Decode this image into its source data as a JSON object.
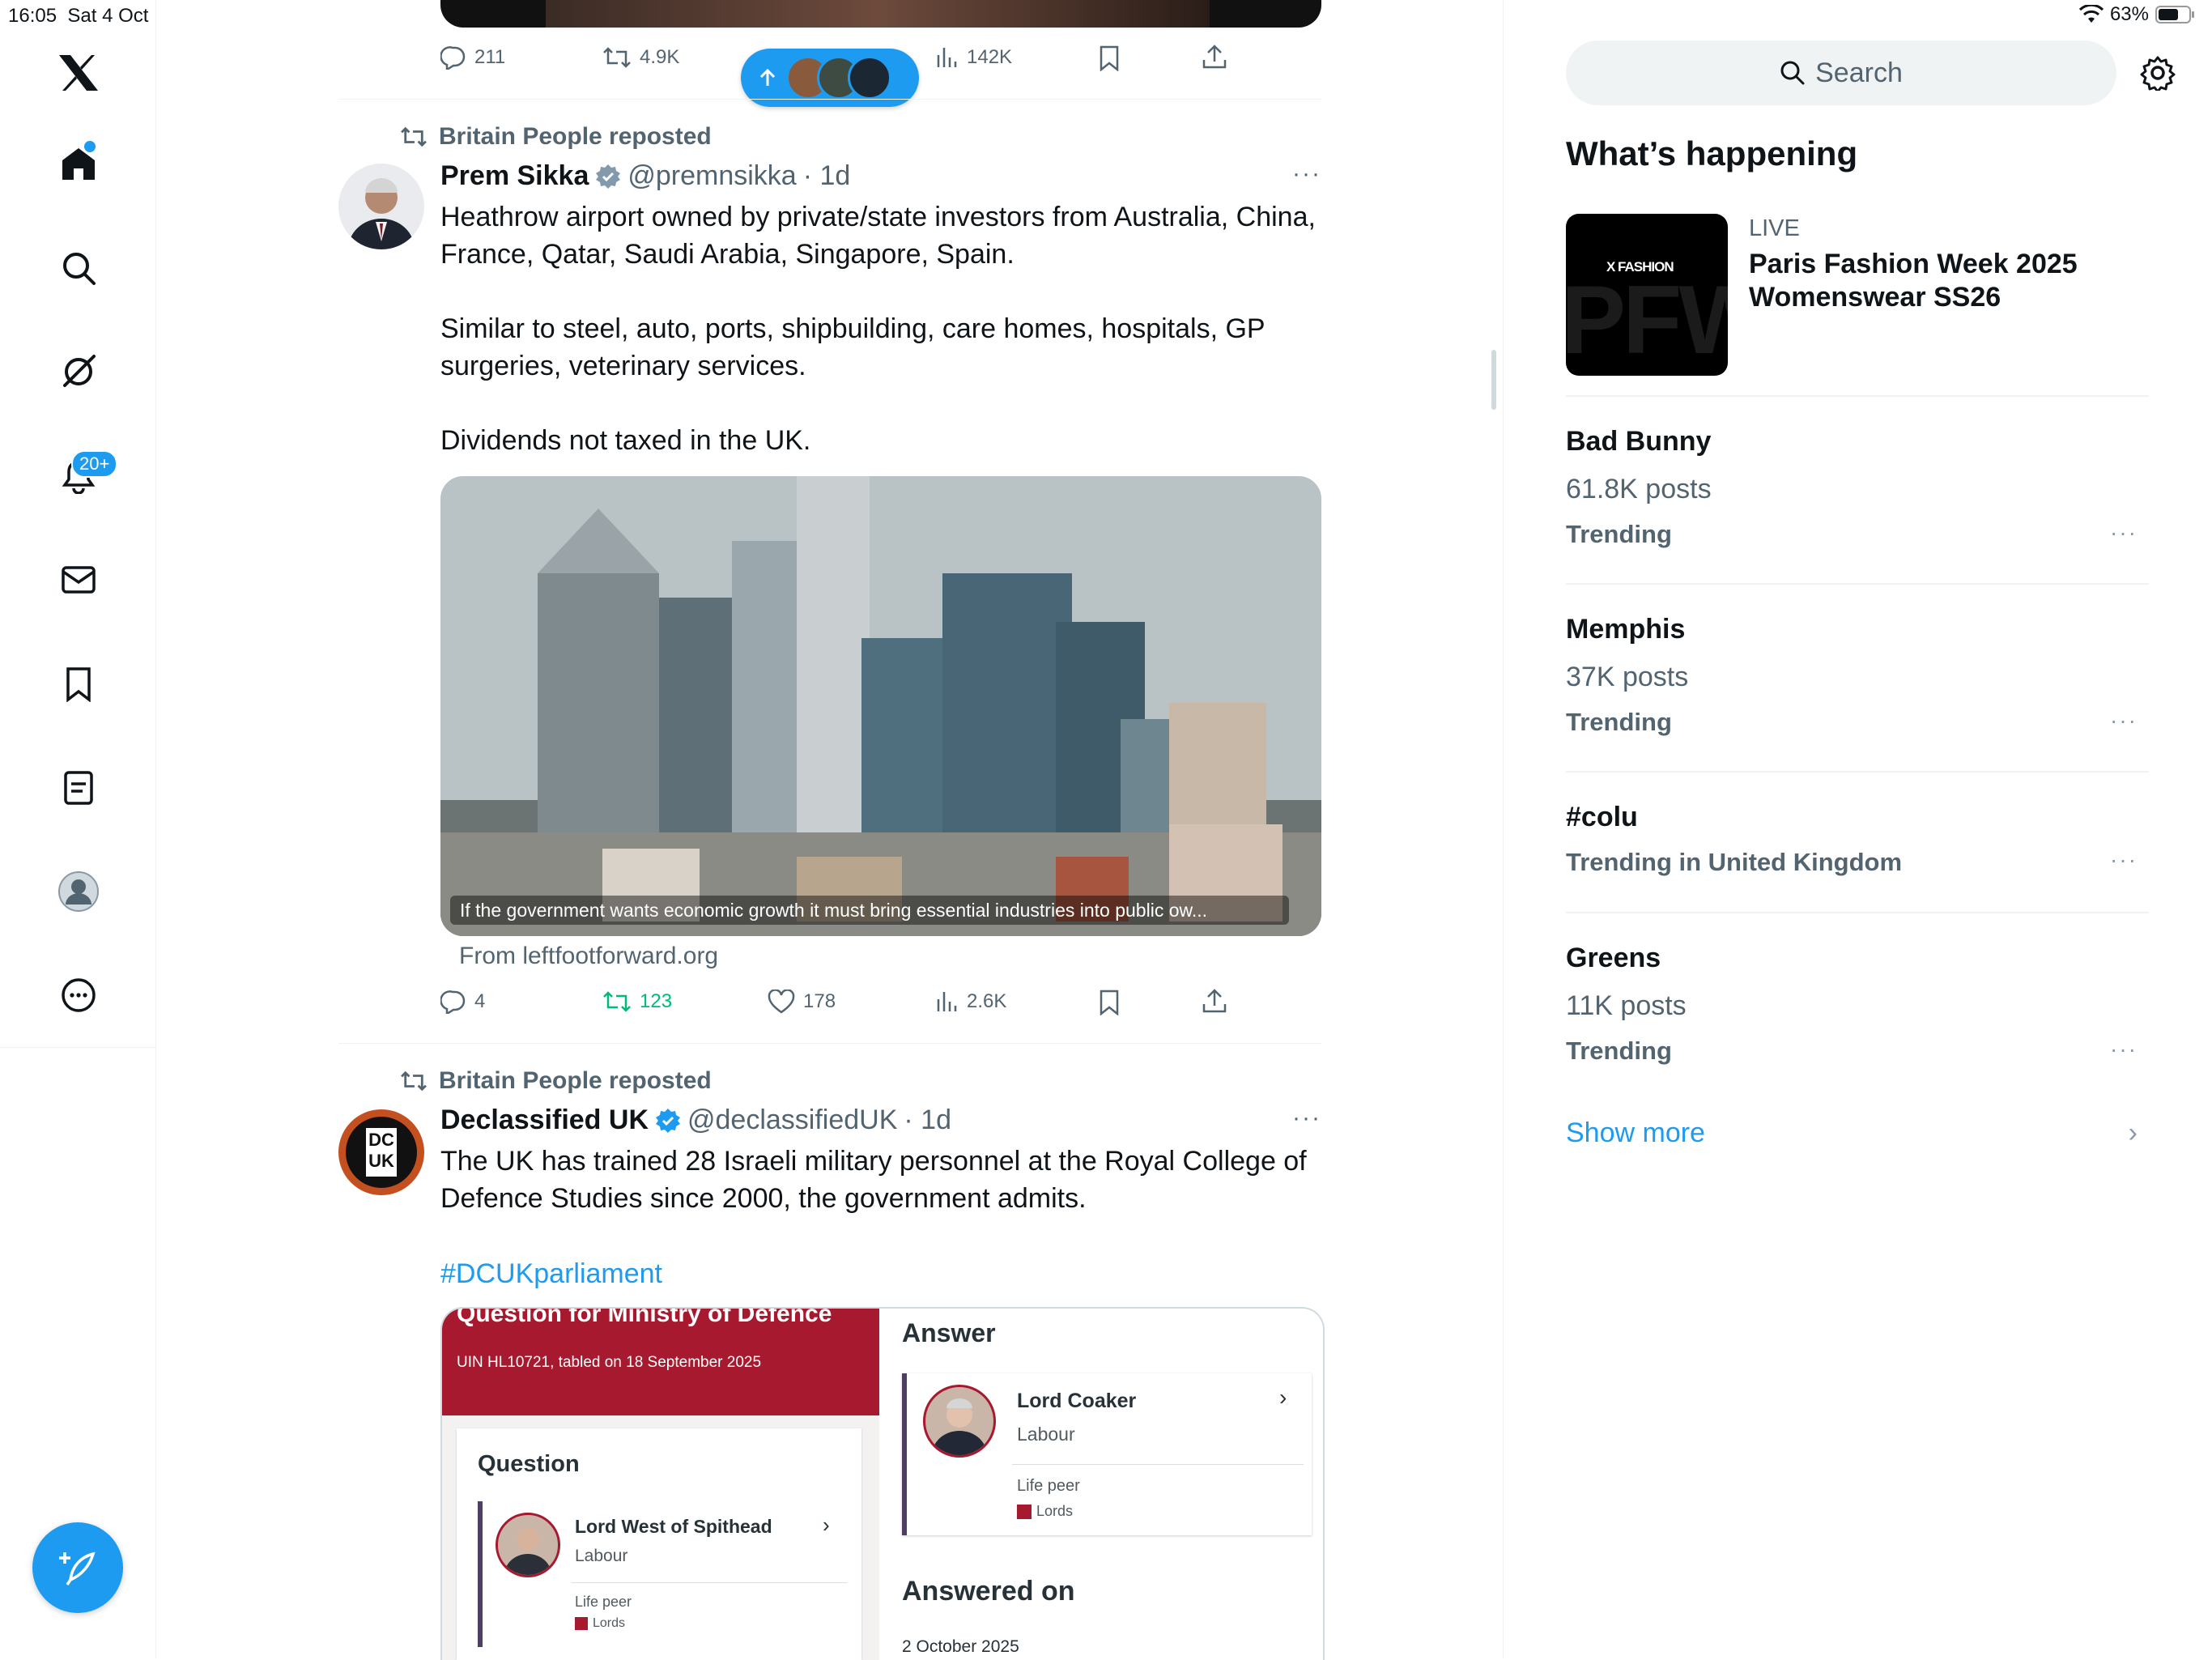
{
  "status": {
    "time": "16:05",
    "date": "Sat 4 Oct",
    "battery": "63%"
  },
  "nav": {
    "notifications_badge": "20+"
  },
  "top_tweet": {
    "replies": "211",
    "reposts": "4.9K",
    "views": "142K"
  },
  "tweet1": {
    "repost_label": "Britain People reposted",
    "name": "Prem Sikka",
    "handle": "@premnsikka",
    "time": "· 1d",
    "text": "Heathrow airport owned by private/state investors from Australia, China, France, Qatar, Saudi Arabia, Singapore, Spain.\n\nSimilar to steel, auto, ports, shipbuilding, care homes, hospitals, GP surgeries, veterinary services.\n\nDividends not taxed in the UK.",
    "card_caption": "If the government wants economic growth it must bring essential industries into public ow...",
    "card_source": "From leftfootforward.org",
    "replies": "4",
    "reposts": "123",
    "likes": "178",
    "views": "2.6K"
  },
  "tweet2": {
    "repost_label": "Britain People reposted",
    "name": "Declassified UK",
    "handle": "@declassifiedUK",
    "time": "· 1d",
    "avatar_text": "DC UK",
    "text": "The UK has trained 28 Israeli military personnel at the Royal College of Defence Studies since 2000, the government admits.",
    "hashtag": "#DCUKparliament",
    "card": {
      "header_title": "Question for Ministry of Defence",
      "uin": "UIN HL10721, tabled on 18 September 2025",
      "question_label": "Question",
      "asker_name": "Lord West of Spithead",
      "asker_party": "Labour",
      "asker_role": "Life peer",
      "asker_house": "Lords",
      "answer_label": "Answer",
      "answerer_name": "Lord Coaker",
      "answerer_party": "Labour",
      "answerer_role": "Life peer",
      "answerer_house": "Lords",
      "answered_on_label": "Answered on",
      "answered_on_date": "2 October 2025"
    }
  },
  "sidebar": {
    "search_placeholder": "Search",
    "heading": "What’s happening",
    "live": {
      "badge": "LIVE",
      "title": "Paris Fashion Week 2025 Womenswear SS26",
      "thumb_label": "X FASHION",
      "thumb_bg": "PFW"
    },
    "trends": [
      {
        "title": "Bad Bunny",
        "posts": "61.8K posts",
        "context": "Trending"
      },
      {
        "title": "Memphis",
        "posts": "37K posts",
        "context": "Trending"
      },
      {
        "title": "#colu",
        "posts": "",
        "context": "Trending in United Kingdom"
      },
      {
        "title": "Greens",
        "posts": "11K posts",
        "context": "Trending"
      }
    ],
    "show_more": "Show more"
  },
  "colors": {
    "accent": "#1d9bf0",
    "repost_green": "#00ba7c",
    "parliament_red": "#a6192e"
  }
}
